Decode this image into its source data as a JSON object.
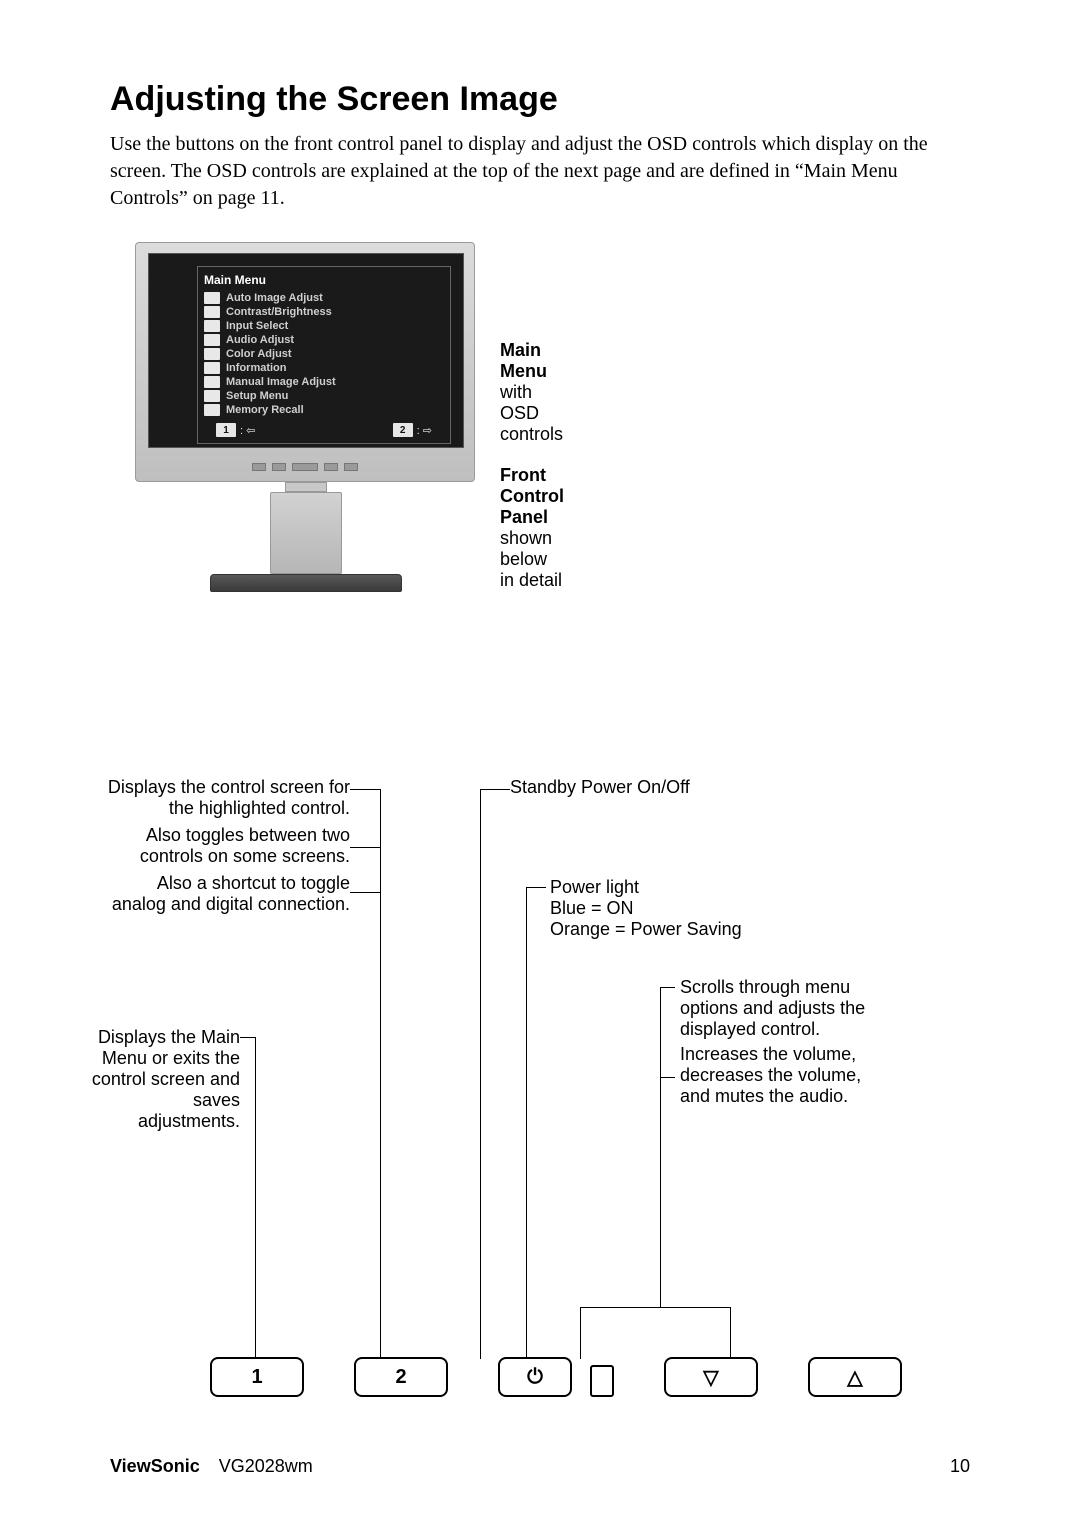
{
  "title": "Adjusting the Screen Image",
  "intro": "Use the buttons on the front control panel to display and adjust the OSD controls which display on the screen. The OSD controls are explained at the top of the next page and are defined in “Main Menu Controls” on page 11.",
  "osd": {
    "title": "Main Menu",
    "items": [
      "Auto Image Adjust",
      "Contrast/Brightness",
      "Input Select",
      "Audio Adjust",
      "Color Adjust",
      "Information",
      "Manual Image Adjust",
      "Setup Menu",
      "Memory Recall"
    ],
    "foot_left": "1",
    "foot_right": "2"
  },
  "side": {
    "main_menu_label": "Main Menu",
    "main_menu_sub": "with OSD controls",
    "front_panel_label": "Front Control Panel",
    "front_panel_sub": "shown below in detail"
  },
  "callouts": {
    "top_left_line1": "Displays the control screen for the highlighted control.",
    "top_left_line2": "Also toggles between two controls on some screens.",
    "top_left_line3": "Also a shortcut to toggle analog and digital connection.",
    "mid_left": "Displays the Main Menu or exits the control screen and saves adjustments.",
    "standby": "Standby Power On/Off",
    "power_light_title": "Power light",
    "power_light_blue": "Blue = ON",
    "power_light_orange": "Orange = Power Saving",
    "scrolls_line1": "Scrolls through menu options and adjusts the displayed control.",
    "scrolls_line2": "Increases the volume, decreases the volume, and mutes the audio."
  },
  "buttons": {
    "b1": "1",
    "b2": "2",
    "power_icon": "⏻",
    "down_icon": "▽",
    "up_icon": "△"
  },
  "footer": {
    "brand": "ViewSonic",
    "model": "VG2028wm",
    "page": "10"
  }
}
